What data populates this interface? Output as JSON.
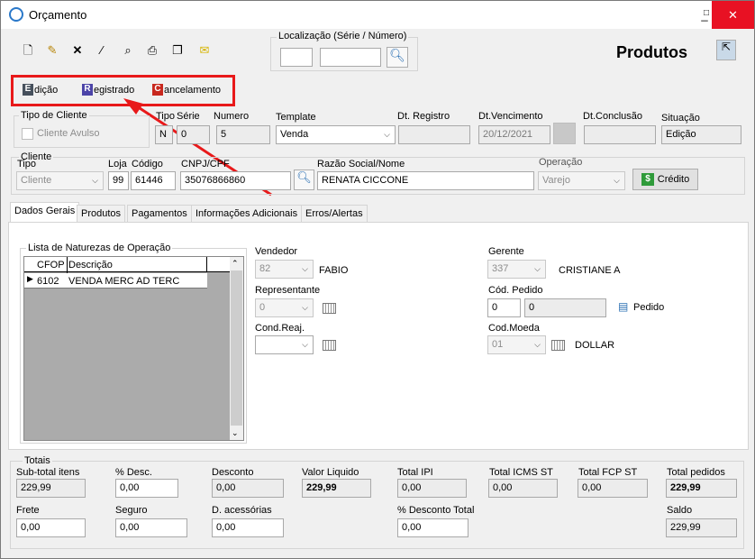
{
  "window": {
    "title": "Orçamento",
    "minimize": "_",
    "maximize": "□",
    "close": "✕"
  },
  "toolbar": {
    "icons": [
      "new-doc-icon",
      "edit-icon",
      "delete-icon",
      "magic-wand-icon",
      "preview-icon",
      "print-icon",
      "copy-icon",
      "email-icon"
    ]
  },
  "localizacao": {
    "label": "Localização (Série / Número)",
    "serie": "",
    "numero": ""
  },
  "header": {
    "title": "Produtos"
  },
  "modes": {
    "edicao": {
      "letter": "E",
      "label": "dição"
    },
    "registrado": {
      "letter": "R",
      "label": "egistrado"
    },
    "cancelamento": {
      "letter": "C",
      "label": "ancelamento"
    }
  },
  "tipo_cliente": {
    "group": "Tipo de Cliente",
    "checkbox": "Cliente Avulso"
  },
  "doc": {
    "tipo_label": "Tipo",
    "serie_label": "Série",
    "tipo": "N",
    "serie": "0",
    "numero_label": "Numero",
    "numero": "5",
    "template_label": "Template",
    "template": "Venda",
    "dt_registro_label": "Dt. Registro",
    "dt_registro": "",
    "dt_vencimento_label": "Dt.Vencimento",
    "dt_vencimento": "20/12/2021",
    "dt_conclusao_label": "Dt.Conclusão",
    "dt_conclusao": "",
    "situacao_label": "Situação",
    "situacao": "Edição"
  },
  "cliente": {
    "group": "Cliente",
    "tipo_label": "Tipo",
    "tipo": "Cliente",
    "loja_label": "Loja",
    "loja": "99",
    "codigo_label": "Código",
    "codigo": "61446",
    "cnpj_label": "CNPJ/CPF",
    "cnpj": "35076866860",
    "razao_label": "Razão Social/Nome",
    "razao": "RENATA CICCONE",
    "operacao_label": "Operação",
    "operacao": "Varejo",
    "credito_btn": "Crédito"
  },
  "tabs": [
    "Dados Gerais",
    "Produtos",
    "Pagamentos",
    "Informações Adicionais",
    "Erros/Alertas"
  ],
  "naturezas": {
    "group": "Lista de Naturezas de Operação",
    "col_cfop": "CFOP",
    "col_desc": "Descrição",
    "rows": [
      {
        "cfop": "6102",
        "desc": "VENDA MERC AD TERC"
      }
    ]
  },
  "dados": {
    "vendedor_label": "Vendedor",
    "vendedor_cod": "82",
    "vendedor_nome": "FABIO",
    "representante_label": "Representante",
    "representante": "0",
    "condreaj_label": "Cond.Reaj.",
    "condreaj": "",
    "gerente_label": "Gerente",
    "gerente_cod": "337",
    "gerente_nome": "CRISTIANE A",
    "codpedido_label": "Cód. Pedido",
    "pedido1": "0",
    "pedido2": "0",
    "pedido_btn": "Pedido",
    "codmoeda_label": "Cod.Moeda",
    "moeda_cod": "01",
    "moeda_nome": "DOLLAR"
  },
  "totais": {
    "group": "Totais",
    "subtotal_label": "Sub-total itens",
    "subtotal": "229,99",
    "pdesc_label": "% Desc.",
    "pdesc": "0,00",
    "desconto_label": "Desconto",
    "desconto": "0,00",
    "valorliq_label": "Valor Liquido",
    "valorliq": "229,99",
    "ipi_label": "Total IPI",
    "ipi": "0,00",
    "icmsst_label": "Total ICMS ST",
    "icmsst": "0,00",
    "fcpst_label": "Total FCP ST",
    "fcpst": "0,00",
    "totped_label": "Total pedidos",
    "totped": "229,99",
    "frete_label": "Frete",
    "frete": "0,00",
    "seguro_label": "Seguro",
    "seguro": "0,00",
    "dacess_label": "D. acessórias",
    "dacess": "0,00",
    "pdesctot_label": "% Desconto Total",
    "pdesctot": "0,00",
    "saldo_label": "Saldo",
    "saldo": "229,99"
  },
  "colors": {
    "annotation": "#e8191a"
  }
}
